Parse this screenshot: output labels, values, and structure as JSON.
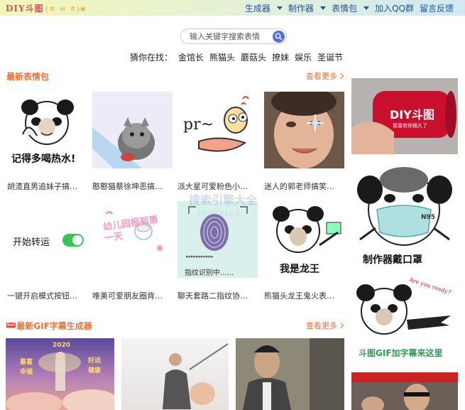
{
  "header": {
    "logo": "DIY斗图",
    "logo_deco": "(ㅎ ㅂ ㅎ)❀",
    "nav": [
      {
        "label": "生成器",
        "dropdown": true
      },
      {
        "label": "制作器",
        "dropdown": true
      },
      {
        "label": "表情包",
        "dropdown": true
      },
      {
        "label": "加入QQ群",
        "dropdown": false
      },
      {
        "label": "留言反馈",
        "dropdown": false
      }
    ]
  },
  "search": {
    "placeholder": "输入关键字搜索表情"
  },
  "guess": {
    "label": "猜你在找：",
    "keywords": [
      "金馆长",
      "熊猫头",
      "蘑菇头",
      "撩妹",
      "娱乐",
      "圣诞节"
    ]
  },
  "latest": {
    "title": "最新表情包",
    "more": "查看更多",
    "items": [
      {
        "caption": "胡渣直男追妹子搞…",
        "image_text": "记得多喝热水!"
      },
      {
        "caption": "憨憨猫蔡徐坤恶搞…",
        "image_text": ""
      },
      {
        "caption": "派大星可爱粉色小…",
        "image_text": "pr~"
      },
      {
        "caption": "迷人的郭老师搞笑…",
        "image_text": ""
      },
      {
        "caption": "一键开启模式按钮…",
        "image_text": "开始转运"
      },
      {
        "caption": "唯美可爱朋友圈背…",
        "image_text": "幼儿园报到第一天"
      },
      {
        "caption": "聊天套路二指纹协…",
        "image_text": "指纹识别中......"
      },
      {
        "caption": "熊猫头龙王鬼火表…",
        "image_text": "我是龙王"
      }
    ]
  },
  "watermark": {
    "main": "搜索引擎大全",
    "sub": "ZHOUBLOG"
  },
  "gif": {
    "title": "最新GIF字幕生成器",
    "hot": "hot",
    "more": "查看更多",
    "items": [
      {
        "texts": [
          "2020",
          "暴富",
          "好运",
          "幸福",
          "健康"
        ]
      },
      {
        "texts": []
      },
      {
        "texts": []
      }
    ]
  },
  "side": {
    "banner1": {
      "title": "DIY斗图",
      "sub": "我喜欢你很久了"
    },
    "banner2": {
      "title": "制作器戴口罩",
      "mask": "N95"
    },
    "banner3": {
      "title": "斗图GIF加字幕来这里",
      "bubble": "Are you ready?"
    }
  },
  "colors": {
    "accent": "#e8743a",
    "nav": "#2a4f9a",
    "logo": "#d94f5f",
    "toggle": "#35c659"
  }
}
